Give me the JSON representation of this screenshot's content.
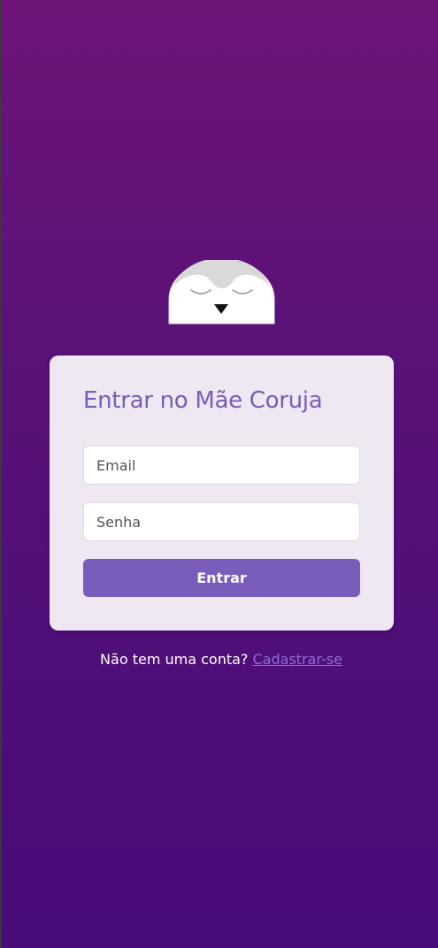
{
  "login": {
    "title": "Entrar no Mãe Coruja",
    "email_placeholder": "Email",
    "password_placeholder": "Senha",
    "submit_label": "Entrar"
  },
  "signup": {
    "prompt": "Não tem uma conta?",
    "link_label": "Cadastrar-se"
  },
  "logo": {
    "icon": "sleeping-owl-icon"
  },
  "colors": {
    "background_top": "#6e1479",
    "background_bottom": "#480c78",
    "card": "#efe7f1",
    "accent": "#7a5cba",
    "link": "#8b6ed3"
  }
}
